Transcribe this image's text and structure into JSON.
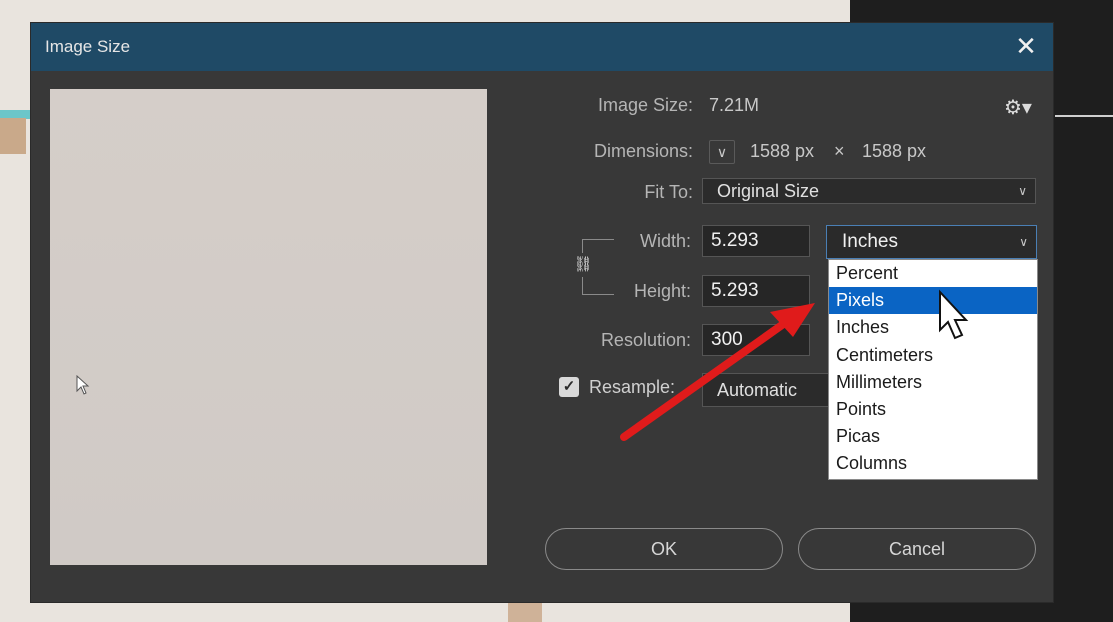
{
  "dialog": {
    "title": "Image Size",
    "close_glyph": "✕",
    "image_size_label": "Image Size:",
    "image_size_value": "7.21M",
    "dimensions_label": "Dimensions:",
    "dimensions_width": "1588 px",
    "dimensions_sep": "×",
    "dimensions_height": "1588 px",
    "fit_to_label": "Fit To:",
    "fit_to_value": "Original Size",
    "width_label": "Width:",
    "width_value": "5.293",
    "height_label": "Height:",
    "height_value": "5.293",
    "resolution_label": "Resolution:",
    "resolution_value": "300",
    "resample_label": "Resample:",
    "resample_checked": true,
    "resample_value": "Automatic",
    "unit_value": "Inches",
    "unit_options": [
      "Percent",
      "Pixels",
      "Inches",
      "Centimeters",
      "Millimeters",
      "Points",
      "Picas",
      "Columns"
    ],
    "unit_highlighted": "Pixels",
    "ok_label": "OK",
    "cancel_label": "Cancel"
  },
  "icons": [
    "close-icon",
    "gear-icon",
    "chevron-down-icon",
    "link-chain-icon",
    "checkmark-icon",
    "mouse-cursor-icon"
  ],
  "colors": {
    "titlebar": "#1f4a66",
    "dialog_bg": "#383838",
    "selection": "#0a64c4",
    "annotation_arrow": "#e01b1b"
  }
}
